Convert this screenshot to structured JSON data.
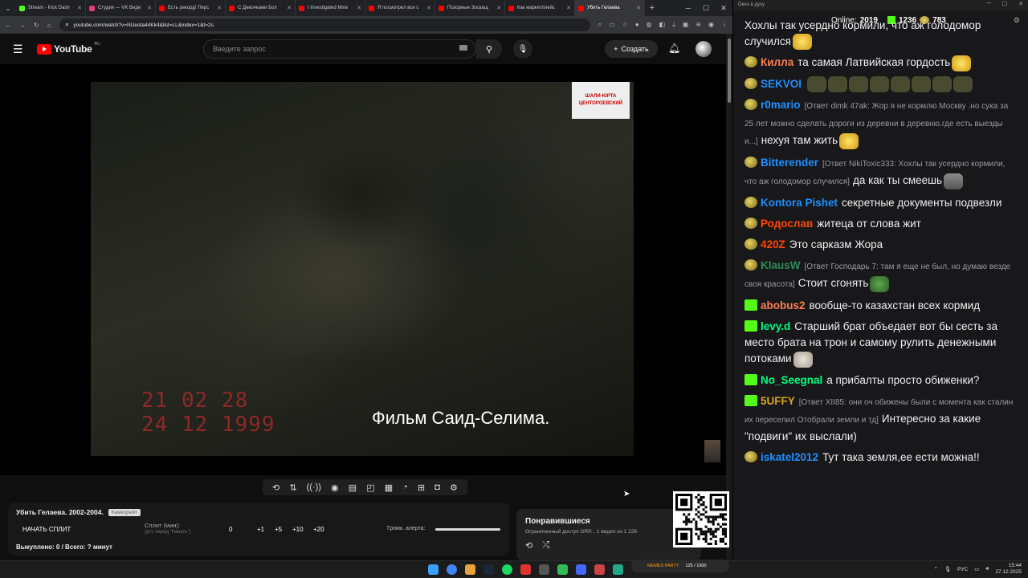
{
  "browser": {
    "tabs": [
      {
        "label": "Stream - Kick Dash",
        "color": "#53fc18"
      },
      {
        "label": "Студия — VK Виде",
        "color": "#e53980"
      },
      {
        "label": "Есть рекорд! Перс",
        "color": "#ff0000"
      },
      {
        "label": "С Девочками Бол",
        "color": "#ff0000"
      },
      {
        "label": "I Investigated Mine",
        "color": "#ff0000"
      },
      {
        "label": "Я посмотрел все с",
        "color": "#ff0000"
      },
      {
        "label": "Позорные Зоозащ",
        "color": "#ff0000"
      },
      {
        "label": "Как маркетплейс",
        "color": "#ff0000"
      },
      {
        "label": "Убить Гелаева",
        "color": "#ff0000",
        "active": true
      }
    ],
    "url": "youtube.com/watch?v=NUeota44Kk4&list=LL&index=1&t=2s"
  },
  "youtube": {
    "logo": "YouTube",
    "region": "RU",
    "search_placeholder": "Введите запрос",
    "create_label": "Создать"
  },
  "video": {
    "watermark": [
      "ШАЛИ-ЮРТА",
      "ЦЕНТОРОЕВСКИЙ"
    ],
    "date_lines": [
      "21 02 28",
      "24 12 1999"
    ],
    "subtitle": "Фильм Саид-Селима."
  },
  "split_panel": {
    "title": "Убить Гелаева. 2002-2004.",
    "tag": "Камкорейт",
    "start_button": "НАЧАТЬ СПЛИТ",
    "split_label": "Сплит (мин):",
    "split_hint": "(уст. перед \"Начать\")",
    "split_value": "0",
    "increments": [
      "+1",
      "+5",
      "+10",
      "+20"
    ],
    "alert_volume_label": "Громк. алерта:",
    "alert_volume": 1.0,
    "bought": "Выкуплено: 0 / Всего: ? минут"
  },
  "liked": {
    "title": "Понравившиеся",
    "subtitle": "Ограниченный доступ  GRP...  1 видео из 1 226"
  },
  "chat": {
    "window_title": "Окно в духу",
    "online_label": "Online:",
    "online": "2019",
    "kick_count": "1236",
    "coin_count": "783",
    "messages": [
      {
        "user": "",
        "color": "#efeff1",
        "badge": "",
        "reply": "",
        "text": "Хохлы так усердно кормили, что аж голодомор случился",
        "emote": "face"
      },
      {
        "user": "Килла",
        "color": "#ff7f50",
        "badge": "g",
        "reply": "",
        "text": "та самая Латвийская гордость",
        "emote": "face"
      },
      {
        "user": "SEKVOI",
        "color": "#1e90ff",
        "badge": "g",
        "reply": "",
        "text": "",
        "emote": "pan"
      },
      {
        "user": "r0mario",
        "color": "#1e90ff",
        "badge": "g",
        "reply": "[Ответ dimk 47ak: Жор я не кормлю Москву .но сука за 25 лет можно сделать дороги из деревни в деревню.где есть выезды и...]",
        "text": "нехуя там жить",
        "emote": "face"
      },
      {
        "user": "Bitterender",
        "color": "#1e90ff",
        "badge": "g",
        "reply": "[Ответ NikiToxic333: Хохлы так усердно кормили, что аж голодомор случился]",
        "text": "да как ты смеешь",
        "emote": "grey"
      },
      {
        "user": "Kontora Pishet",
        "color": "#1e90ff",
        "badge": "g",
        "reply": "",
        "text": "секретные документы подвезли",
        "emote": ""
      },
      {
        "user": "Родослав",
        "color": "#ff4500",
        "badge": "g",
        "reply": "",
        "text": "житеца от слова жит",
        "emote": ""
      },
      {
        "user": "420Z",
        "color": "#ff4500",
        "badge": "g",
        "reply": "",
        "text": "Это сарказм Жора",
        "emote": ""
      },
      {
        "user": "KlausW",
        "color": "#2e8b57",
        "badge": "g",
        "reply": "[Ответ Господарь 7: там я еще не был, но думаю везде своя красота]",
        "text": "Стоит сгонять",
        "emote": "pepe"
      },
      {
        "user": "abobus2",
        "color": "#ff7f50",
        "badge": "k",
        "reply": "",
        "text": "вообще-то казахстан всех кормид",
        "emote": ""
      },
      {
        "user": "levy.d",
        "color": "#00ff7f",
        "badge": "k",
        "reply": "",
        "text": "Старший брат объедает вот бы сесть за место брата на трон и самому рулить денежными потоками",
        "emote": "dog"
      },
      {
        "user": "No_Seegnal",
        "color": "#00ff7f",
        "badge": "k",
        "reply": "",
        "text": "а прибалты просто обиженки?",
        "emote": ""
      },
      {
        "user": "5UFFY",
        "color": "#daa520",
        "badge": "k",
        "reply": "[Ответ XII85: они оч обижены были с момента как сталин их переселил Отобрали земли и тд]",
        "text": "Интересно за какие \"подвиги\" их выслали)",
        "emote": ""
      },
      {
        "user": "iskatel2012",
        "color": "#1e90ff",
        "badge": "g",
        "reply": "",
        "text": "Тут така земля,ее ести можна!!",
        "emote": ""
      }
    ]
  },
  "taskbar": {
    "memes_label": "MEMES PARTY",
    "memes_progress": "125 / 1500",
    "lang": "РУС",
    "time": "15:44",
    "date": "27.12.2025"
  }
}
